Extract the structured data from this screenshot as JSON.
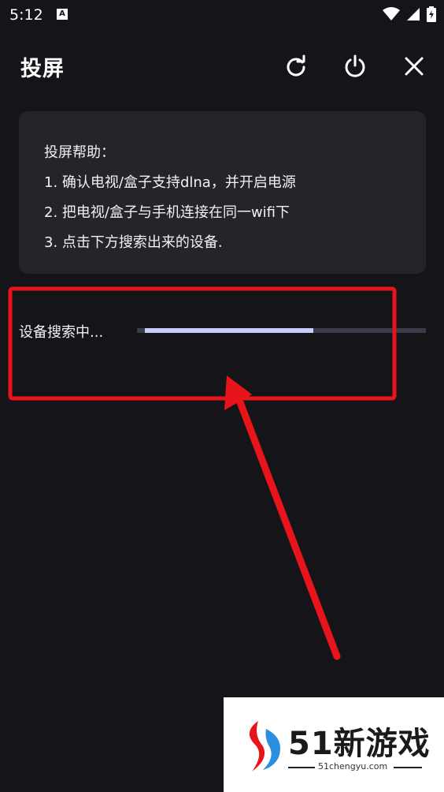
{
  "status_bar": {
    "time": "5:12",
    "notification_badge": "A"
  },
  "header": {
    "title": "投屏"
  },
  "help": {
    "lines": [
      "投屏帮助：",
      "1. 确认电视/盒子支持dlna，并开启电源",
      "2. 把电视/盒子与手机连接在同一wifi下",
      "3. 点击下方搜索出来的设备."
    ]
  },
  "search": {
    "label": "设备搜索中...",
    "progress": 0.6
  },
  "watermark": {
    "brand": "51新游戏",
    "url": "51chengyu.com"
  },
  "colors": {
    "background": "#141419",
    "card": "#24242b",
    "progress": "#c9ceff",
    "annotation": "#e8141b"
  }
}
